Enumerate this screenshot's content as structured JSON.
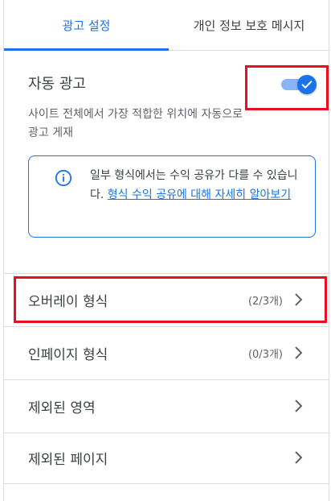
{
  "tabs": [
    {
      "label": "광고 설정",
      "active": true
    },
    {
      "label": "개인 정보 보호 메시지",
      "active": false
    }
  ],
  "auto_ads": {
    "title": "자동 광고",
    "description": "사이트 전체에서 가장 적합한 위치에 자동으로 광고 게재",
    "toggle_on": true
  },
  "info": {
    "text": "일부 형식에서는 수익 공유가 다를 수 있습니다.",
    "link": "형식 수익 공유에 대해 자세히 알아보기"
  },
  "rows": [
    {
      "label": "오버레이 형식",
      "count": "(2/3개)"
    },
    {
      "label": "인페이지 형식",
      "count": "(0/3개)"
    },
    {
      "label": "제외된 영역",
      "count": ""
    },
    {
      "label": "제외된 페이지",
      "count": ""
    }
  ],
  "icons": {
    "info": "info-icon",
    "chevron": "chevron-right-icon",
    "check": "check-icon"
  },
  "colors": {
    "accent": "#1a73e8",
    "highlight": "#e8101f",
    "toggle_track": "#8ab4f8"
  }
}
